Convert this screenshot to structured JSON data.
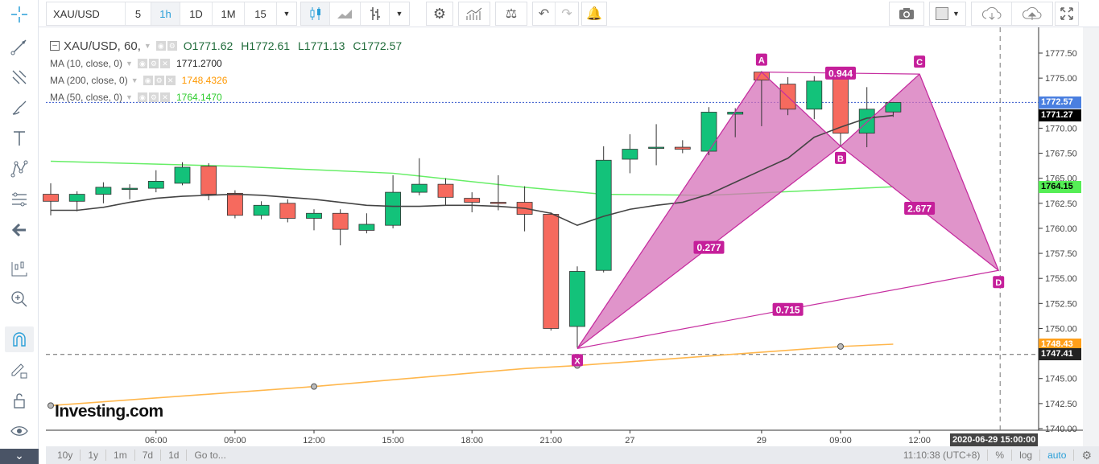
{
  "toolbar": {
    "symbol": "XAU/USD",
    "intervals": [
      "5",
      "1h",
      "1D",
      "1M",
      "15"
    ],
    "active_interval": "1h"
  },
  "legend": {
    "title": "XAU/USD, 60,",
    "open": "O1771.62",
    "high": "H1772.61",
    "low": "L1771.13",
    "close": "C1772.57",
    "ma": [
      {
        "label": "MA (10, close, 0)",
        "value": "1771.2700",
        "color": "#222222"
      },
      {
        "label": "MA (200, close, 0)",
        "value": "1748.4326",
        "color": "#ff9800"
      },
      {
        "label": "MA (50, close, 0)",
        "value": "1764.1470",
        "color": "#33dd33"
      }
    ]
  },
  "price_tags": [
    {
      "value": "1772.57",
      "bg": "#4a7fe0",
      "fg": "#ffffff",
      "price": 1772.57
    },
    {
      "value": "1771.27",
      "bg": "#000000",
      "fg": "#ffffff",
      "price": 1771.27
    },
    {
      "value": "1764.15",
      "bg": "#55ee55",
      "fg": "#000000",
      "price": 1764.15
    },
    {
      "value": "1748.43",
      "bg": "#ff9f1a",
      "fg": "#ffffff",
      "price": 1748.43
    },
    {
      "value": "1747.41",
      "bg": "#222222",
      "fg": "#ffffff",
      "price": 1747.41
    }
  ],
  "cursor_time": "2020-06-29 15:00:00",
  "bottom": {
    "ranges": [
      "10y",
      "1y",
      "1m",
      "7d",
      "1d",
      "Go to..."
    ],
    "clock": "11:10:38 (UTC+8)",
    "percent": "%",
    "log": "log",
    "auto": "auto"
  },
  "watermark": "Investing.com",
  "chart_data": {
    "type": "candlestick",
    "symbol": "XAU/USD",
    "interval": "60",
    "ylim": [
      1738.8,
      1779.0
    ],
    "y_ticks": [
      1740.0,
      1742.5,
      1745.0,
      1747.5,
      1750.0,
      1752.5,
      1755.0,
      1757.5,
      1760.0,
      1762.5,
      1765.0,
      1767.5,
      1770.0,
      1772.5,
      1775.0,
      1777.5
    ],
    "x_ticks": [
      {
        "i": 4,
        "label": "06:00"
      },
      {
        "i": 7,
        "label": "09:00"
      },
      {
        "i": 10,
        "label": "12:00"
      },
      {
        "i": 13,
        "label": "15:00"
      },
      {
        "i": 16,
        "label": "18:00"
      },
      {
        "i": 19,
        "label": "21:00"
      },
      {
        "i": 22,
        "label": "27"
      },
      {
        "i": 27,
        "label": "29"
      },
      {
        "i": 30,
        "label": "09:00"
      },
      {
        "i": 33,
        "label": "12:00"
      }
    ],
    "cursor_index": 36,
    "candles": [
      [
        1763.4,
        1764.5,
        1761.3,
        1762.7
      ],
      [
        1762.7,
        1763.7,
        1761.7,
        1763.4
      ],
      [
        1763.4,
        1764.6,
        1762.5,
        1764.1
      ],
      [
        1763.9,
        1764.4,
        1762.9,
        1764.0
      ],
      [
        1764.0,
        1765.8,
        1763.6,
        1764.7
      ],
      [
        1764.5,
        1766.6,
        1764.3,
        1766.1
      ],
      [
        1766.2,
        1766.5,
        1762.8,
        1763.4
      ],
      [
        1763.5,
        1763.8,
        1761.0,
        1761.3
      ],
      [
        1761.3,
        1762.7,
        1760.9,
        1762.3
      ],
      [
        1762.5,
        1762.9,
        1760.6,
        1761.0
      ],
      [
        1761.0,
        1761.9,
        1759.8,
        1761.5
      ],
      [
        1761.5,
        1761.9,
        1758.3,
        1759.9
      ],
      [
        1759.8,
        1761.5,
        1759.5,
        1760.4
      ],
      [
        1760.3,
        1765.3,
        1760.0,
        1763.6
      ],
      [
        1763.6,
        1767.0,
        1763.3,
        1764.4
      ],
      [
        1764.4,
        1765.0,
        1762.3,
        1763.1
      ],
      [
        1763.0,
        1763.6,
        1761.6,
        1762.6
      ],
      [
        1762.6,
        1765.3,
        1761.8,
        1762.5
      ],
      [
        1762.6,
        1764.2,
        1759.7,
        1761.4
      ],
      [
        1761.4,
        1761.6,
        1749.8,
        1750.0
      ],
      [
        1750.2,
        1756.2,
        1748.1,
        1755.7
      ],
      [
        1755.8,
        1768.2,
        1755.6,
        1766.8
      ],
      [
        1766.9,
        1769.4,
        1765.5,
        1767.9
      ],
      [
        1768.0,
        1770.4,
        1766.3,
        1768.1
      ],
      [
        1768.1,
        1768.8,
        1767.5,
        1767.9
      ],
      [
        1767.7,
        1772.1,
        1767.3,
        1771.6
      ],
      [
        1771.4,
        1772.0,
        1769.1,
        1771.6
      ],
      [
        1775.6,
        1775.7,
        1770.2,
        1774.8
      ],
      [
        1774.4,
        1775.1,
        1771.3,
        1771.9
      ],
      [
        1771.9,
        1775.2,
        1770.9,
        1774.7
      ],
      [
        1774.9,
        1775.0,
        1768.2,
        1769.5
      ],
      [
        1769.5,
        1774.1,
        1768.1,
        1771.9
      ],
      [
        1771.62,
        1772.61,
        1771.13,
        1772.57
      ]
    ],
    "ma10": [
      1761.8,
      1761.8,
      1762.1,
      1762.6,
      1763.0,
      1763.2,
      1763.3,
      1763.4,
      1763.3,
      1763.1,
      1762.9,
      1762.6,
      1762.3,
      1762.2,
      1762.2,
      1762.3,
      1762.3,
      1762.2,
      1762.0,
      1761.5,
      1760.3,
      1761.2,
      1761.9,
      1762.3,
      1762.6,
      1763.4,
      1764.6,
      1765.8,
      1767.0,
      1769.1,
      1770.1,
      1771.0,
      1771.27
    ],
    "ma50": [
      [
        0,
        1766.7
      ],
      [
        7,
        1766.2
      ],
      [
        13,
        1765.5
      ],
      [
        18,
        1764.1
      ],
      [
        21,
        1763.4
      ],
      [
        25,
        1763.3
      ],
      [
        32,
        1764.15
      ]
    ],
    "ma200": [
      [
        0,
        1742.3
      ],
      [
        10,
        1744.2
      ],
      [
        18,
        1746.0
      ],
      [
        20,
        1746.3
      ],
      [
        30,
        1748.2
      ],
      [
        32,
        1748.43
      ]
    ],
    "ma200_markers": [
      0,
      10,
      20,
      30
    ],
    "xabcd": {
      "points": [
        {
          "name": "X",
          "i": 20,
          "p": 1748.0
        },
        {
          "name": "A",
          "i": 27,
          "p": 1775.6
        },
        {
          "name": "B",
          "i": 30,
          "p": 1768.2
        },
        {
          "name": "C",
          "i": 33,
          "p": 1775.4
        },
        {
          "name": "D",
          "i": 36,
          "p": 1755.8
        }
      ],
      "ratios": [
        {
          "label": "0.277",
          "from": "X",
          "to": "B"
        },
        {
          "label": "0.944",
          "from": "A",
          "to": "C"
        },
        {
          "label": "2.677",
          "from": "B",
          "to": "D"
        },
        {
          "label": "0.715",
          "from": "X",
          "to": "D"
        }
      ]
    },
    "hlines": [
      {
        "price": 1772.57,
        "style": "dotted",
        "color": "#3355cc"
      },
      {
        "price": 1747.41,
        "style": "dashed",
        "color": "#666666"
      }
    ]
  }
}
